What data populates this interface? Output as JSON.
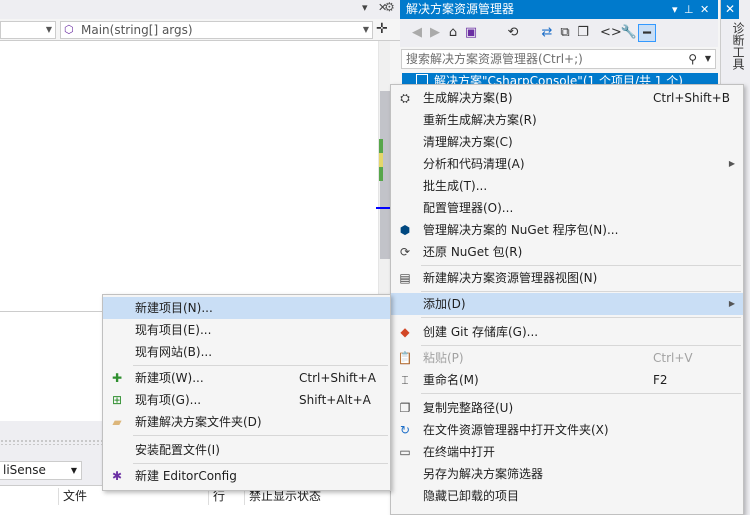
{
  "editor": {
    "nav_left": "",
    "nav_method": "Main(string[] args)",
    "intellisense": "liSense",
    "error_columns": [
      "文件",
      "行",
      "禁止显示状态"
    ]
  },
  "solution_explorer": {
    "title": "解决方案资源管理器",
    "search_placeholder": "搜索解决方案资源管理器(Ctrl+;)",
    "selected_item": "解决方案\"CsharpConsole\"(1 个项目/共 1 个)"
  },
  "side_tab": {
    "label": "诊断工具"
  },
  "context_menu": {
    "items": [
      {
        "label": "生成解决方案(B)",
        "shortcut": "Ctrl+Shift+B",
        "icon": "build-icon"
      },
      {
        "label": "重新生成解决方案(R)",
        "shortcut": ""
      },
      {
        "label": "清理解决方案(C)",
        "shortcut": ""
      },
      {
        "label": "分析和代码清理(A)",
        "shortcut": "",
        "submenu": true
      },
      {
        "label": "批生成(T)...",
        "shortcut": ""
      },
      {
        "label": "配置管理器(O)...",
        "shortcut": ""
      },
      {
        "label": "管理解决方案的 NuGet 程序包(N)...",
        "shortcut": "",
        "icon": "nuget-icon"
      },
      {
        "label": "还原 NuGet 包(R)",
        "shortcut": "",
        "icon": "restore-icon"
      },
      {
        "label": "新建解决方案资源管理器视图(N)",
        "shortcut": "",
        "icon": "new-view-icon"
      },
      {
        "label": "添加(D)",
        "shortcut": "",
        "submenu": true,
        "highlighted": true
      },
      {
        "label": "创建 Git 存储库(G)...",
        "shortcut": "",
        "icon": "git-icon"
      },
      {
        "label": "粘贴(P)",
        "shortcut": "Ctrl+V",
        "disabled": true,
        "icon": "paste-icon"
      },
      {
        "label": "重命名(M)",
        "shortcut": "F2",
        "icon": "rename-icon"
      },
      {
        "label": "复制完整路径(U)",
        "shortcut": "",
        "icon": "copy-path-icon"
      },
      {
        "label": "在文件资源管理器中打开文件夹(X)",
        "shortcut": "",
        "icon": "open-folder-icon"
      },
      {
        "label": "在终端中打开",
        "shortcut": "",
        "icon": "terminal-icon"
      },
      {
        "label": "另存为解决方案筛选器",
        "shortcut": ""
      },
      {
        "label": "隐藏已卸载的项目",
        "shortcut": ""
      }
    ]
  },
  "add_submenu": {
    "items": [
      {
        "label": "新建项目(N)...",
        "shortcut": "",
        "highlighted": true
      },
      {
        "label": "现有项目(E)...",
        "shortcut": ""
      },
      {
        "label": "现有网站(B)...",
        "shortcut": ""
      },
      {
        "label": "新建项(W)...",
        "shortcut": "Ctrl+Shift+A",
        "icon": "new-item-icon"
      },
      {
        "label": "现有项(G)...",
        "shortcut": "Shift+Alt+A",
        "icon": "existing-item-icon"
      },
      {
        "label": "新建解决方案文件夹(D)",
        "shortcut": "",
        "icon": "folder-icon"
      },
      {
        "label": "安装配置文件(I)",
        "shortcut": ""
      },
      {
        "label": "新建 EditorConfig",
        "shortcut": "",
        "icon": "editorconfig-icon"
      }
    ]
  }
}
